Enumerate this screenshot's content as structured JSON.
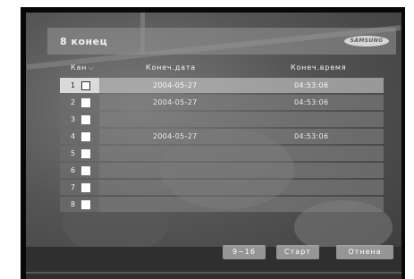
{
  "dialog": {
    "title": "8 конец",
    "logo": "SAMSUNG"
  },
  "table": {
    "headers": {
      "channel": "Кан",
      "date": "Конеч.дата",
      "time": "Конеч.время"
    },
    "rows": [
      {
        "num": "1",
        "date": "2004-05-27",
        "time": "04:53:06"
      },
      {
        "num": "2",
        "date": "2004-05-27",
        "time": "04:53:06"
      },
      {
        "num": "3",
        "date": "",
        "time": ""
      },
      {
        "num": "4",
        "date": "2004-05-27",
        "time": "04:53:06"
      },
      {
        "num": "5",
        "date": "",
        "time": ""
      },
      {
        "num": "6",
        "date": "",
        "time": ""
      },
      {
        "num": "7",
        "date": "",
        "time": ""
      },
      {
        "num": "8",
        "date": "",
        "time": ""
      }
    ]
  },
  "buttons": {
    "page": "9~16",
    "start": "Старт",
    "cancel": "Отнена"
  }
}
